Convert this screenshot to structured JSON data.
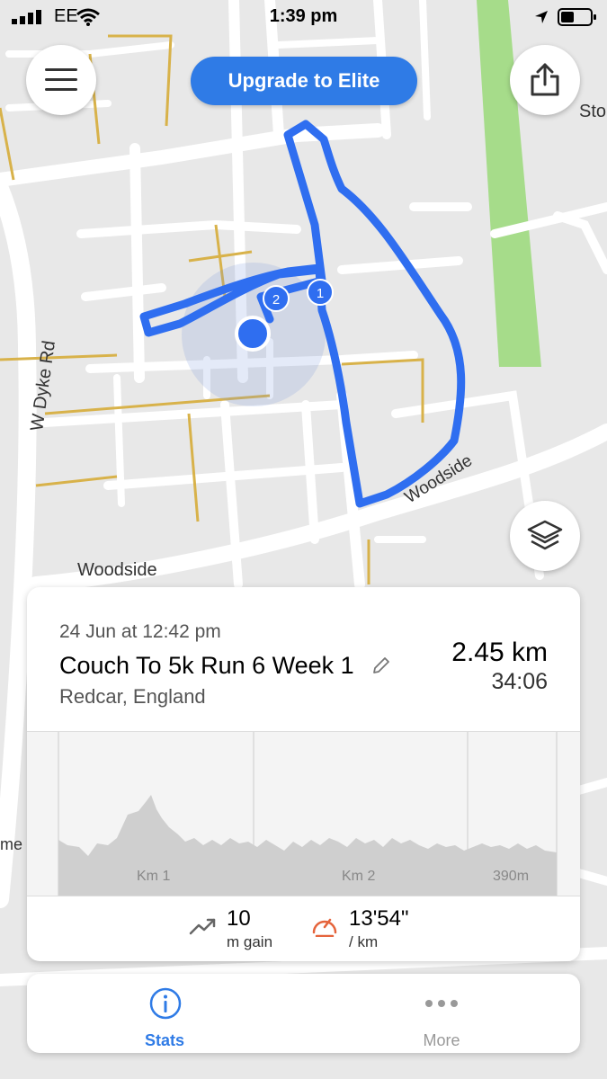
{
  "status_bar": {
    "carrier": "EE",
    "time": "1:39 pm"
  },
  "header": {
    "upgrade_label": "Upgrade to Elite"
  },
  "map": {
    "street_labels": [
      "W Dyke Rd",
      "Woodside",
      "Woodside",
      "Sto",
      "me"
    ],
    "split_markers": [
      "1",
      "2"
    ]
  },
  "activity": {
    "date": "24 Jun at 12:42 pm",
    "title": "Couch To 5k Run 6 Week 1",
    "location": "Redcar, England",
    "distance": "2.45 km",
    "duration": "34:06"
  },
  "elevation_chart": {
    "labels": [
      "Km 1",
      "Km 2",
      "390m"
    ]
  },
  "stats": {
    "gain_value": "10",
    "gain_unit": "m gain",
    "pace_value": "13'54\"",
    "pace_unit": "/ km"
  },
  "tabs": [
    {
      "label": "Stats"
    },
    {
      "label": "More"
    }
  ],
  "colors": {
    "accent": "#2f7be6",
    "route": "#2f6ef0",
    "park": "#a6dc8a",
    "pace_icon": "#e5643c"
  }
}
